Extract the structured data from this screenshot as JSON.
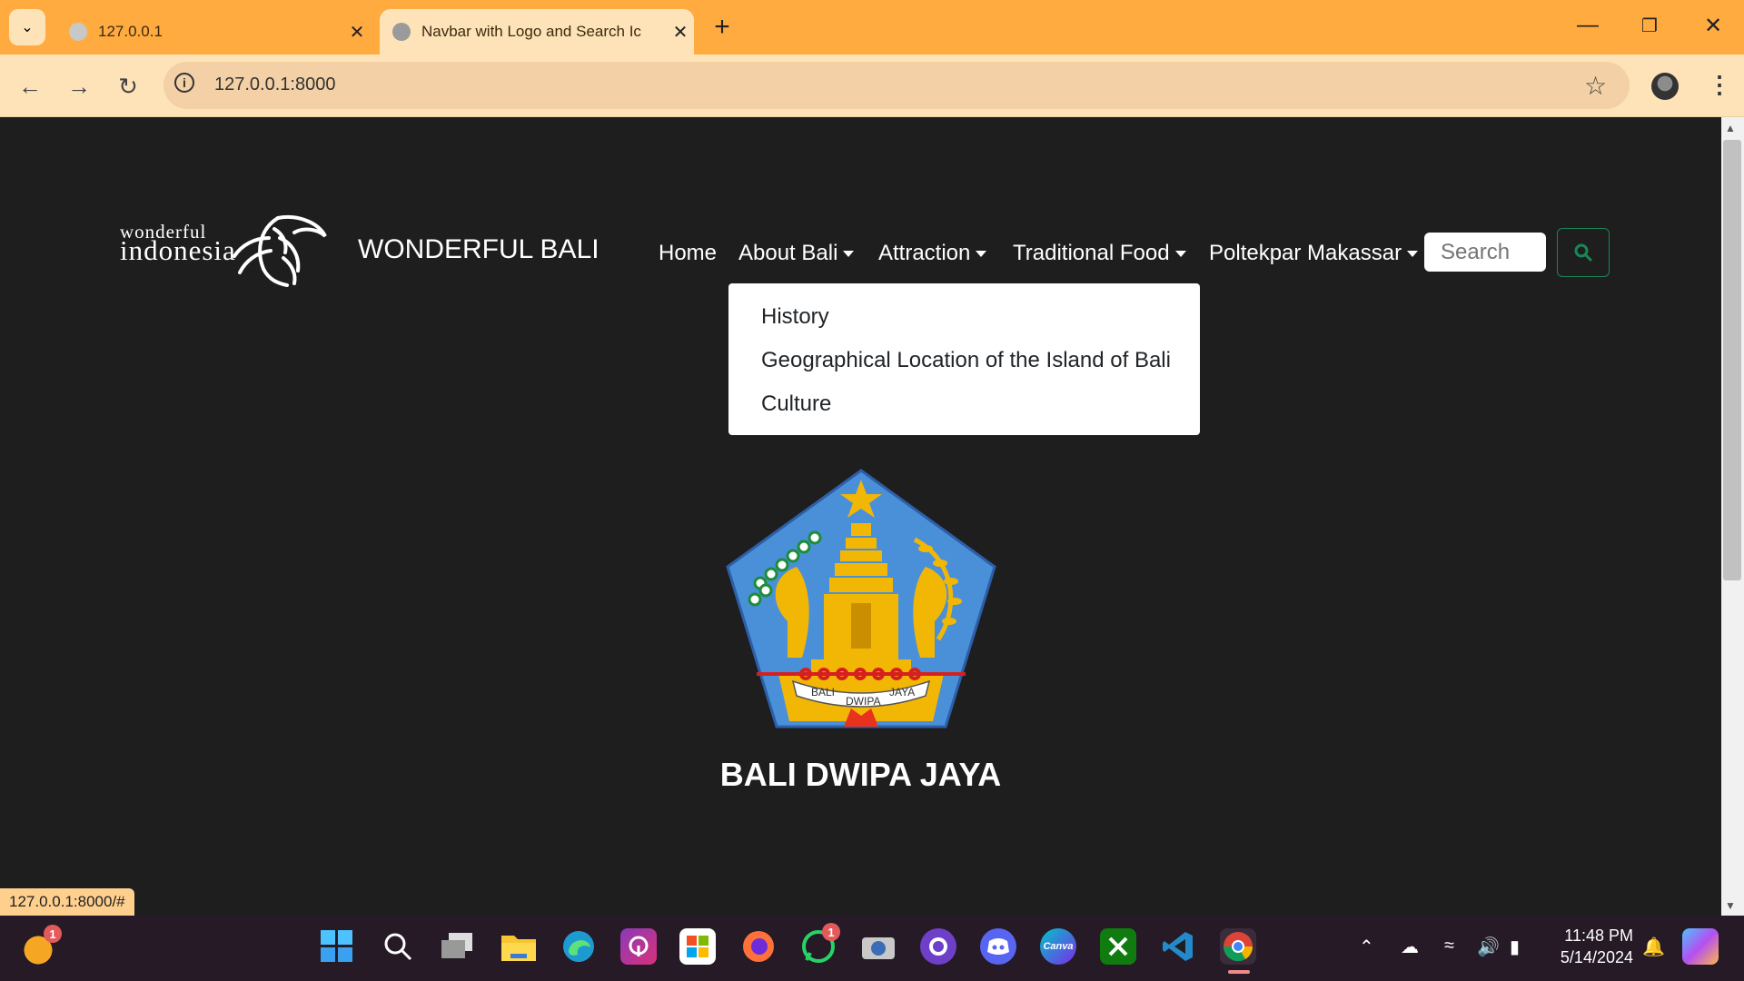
{
  "browser": {
    "tabs": [
      {
        "title": "127.0.0.1",
        "active": false
      },
      {
        "title": "Navbar with Logo and Search Ic",
        "active": true
      }
    ],
    "url": "127.0.0.1:8000",
    "status_url": "127.0.0.1:8000/#"
  },
  "logo": {
    "line1": "wonderful",
    "line2": "indonesia"
  },
  "navbar": {
    "brand": "WONDERFUL BALI",
    "items": [
      {
        "label": "Home",
        "dropdown": false
      },
      {
        "label": "About Bali",
        "dropdown": true
      },
      {
        "label": "Attraction",
        "dropdown": true
      },
      {
        "label": "Traditional Food",
        "dropdown": true
      },
      {
        "label": "Poltekpar Makassar",
        "dropdown": true
      }
    ],
    "search_placeholder": "Search"
  },
  "dropdown": {
    "items": [
      "History",
      "Geographical Location of the Island of Bali",
      "Culture"
    ]
  },
  "emblem": {
    "ribbon_text": [
      "BALI",
      "DWIPA",
      "JAYA"
    ]
  },
  "main": {
    "heading": "BALI DWIPA JAYA"
  },
  "taskbar": {
    "apps": [
      "start",
      "search",
      "task-view",
      "file-explorer",
      "edge",
      "app",
      "store",
      "firefox",
      "whatsapp",
      "camera",
      "github",
      "discord",
      "canva",
      "xbox",
      "vscode",
      "chrome"
    ],
    "canva_label": "Canva",
    "weather_badge": "1",
    "whatsapp_badge": "1",
    "time": "11:48 PM",
    "date": "5/14/2024"
  },
  "colors": {
    "chrome_frame": "#ffab40",
    "chrome_toolbar": "#ffe3b8",
    "page_bg": "#1e1e1f",
    "search_btn": "#198754",
    "emblem_blue": "#4a90d9",
    "emblem_gold": "#f2b705"
  }
}
